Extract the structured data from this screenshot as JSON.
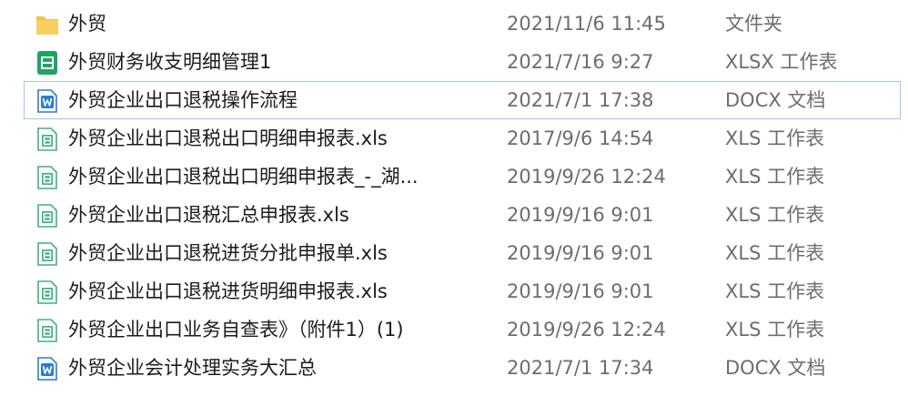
{
  "files": [
    {
      "name": "外贸",
      "date": "2021/11/6 11:45",
      "type": "文件夹",
      "icon": "folder-icon",
      "selected": false
    },
    {
      "name": "外贸财务收支明细管理1",
      "date": "2021/7/16 9:27",
      "type": "XLSX 工作表",
      "icon": "xlsx-icon",
      "selected": false
    },
    {
      "name": "外贸企业出口退税操作流程",
      "date": "2021/7/1 17:38",
      "type": "DOCX 文档",
      "icon": "docx-icon",
      "selected": true
    },
    {
      "name": "外贸企业出口退税出口明细申报表.xls",
      "date": "2017/9/6 14:54",
      "type": "XLS 工作表",
      "icon": "xls-icon",
      "selected": false
    },
    {
      "name": "外贸企业出口退税出口明细申报表_-_湖...",
      "date": "2019/9/26 12:24",
      "type": "XLS 工作表",
      "icon": "xls-icon",
      "selected": false
    },
    {
      "name": "外贸企业出口退税汇总申报表.xls",
      "date": "2019/9/16 9:01",
      "type": "XLS 工作表",
      "icon": "xls-icon",
      "selected": false
    },
    {
      "name": "外贸企业出口退税进货分批申报单.xls",
      "date": "2019/9/16 9:01",
      "type": "XLS 工作表",
      "icon": "xls-icon",
      "selected": false
    },
    {
      "name": "外贸企业出口退税进货明细申报表.xls",
      "date": "2019/9/16 9:01",
      "type": "XLS 工作表",
      "icon": "xls-icon",
      "selected": false
    },
    {
      "name": "外贸企业出口业务自查表》（附件1）(1)",
      "date": "2019/9/26 12:24",
      "type": "XLS 工作表",
      "icon": "xls-icon",
      "selected": false
    },
    {
      "name": "外贸企业会计处理实务大汇总",
      "date": "2021/7/1 17:34",
      "type": "DOCX 文档",
      "icon": "docx-icon",
      "selected": false
    }
  ],
  "colors": {
    "folder": "#f6c244",
    "xlsx_green": "#21a366",
    "xls_green": "#3fb27f",
    "docx_blue": "#2b7cd3",
    "selection_border": "#9dc8f1",
    "secondary_text": "#6d6d6d"
  }
}
